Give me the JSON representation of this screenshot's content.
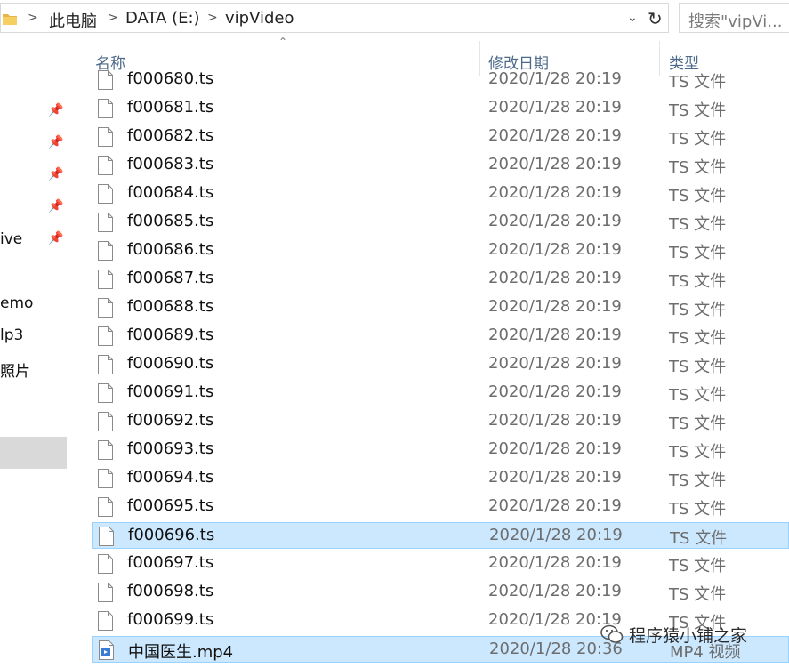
{
  "address": {
    "crumbs": [
      "此电脑",
      "DATA (E:)",
      "vipVideo"
    ],
    "separator": ">"
  },
  "search": {
    "placeholder": "搜索\"vipVi..."
  },
  "nav": {
    "labels": [
      "ive",
      "emo",
      "lp3",
      "照片"
    ]
  },
  "columns": {
    "name": "名称",
    "date": "修改日期",
    "type": "类型"
  },
  "files": [
    {
      "name": "f000680.ts",
      "date": "2020/1/28 20:19",
      "type": "TS 文件",
      "kind": "ts"
    },
    {
      "name": "f000681.ts",
      "date": "2020/1/28 20:19",
      "type": "TS 文件",
      "kind": "ts"
    },
    {
      "name": "f000682.ts",
      "date": "2020/1/28 20:19",
      "type": "TS 文件",
      "kind": "ts"
    },
    {
      "name": "f000683.ts",
      "date": "2020/1/28 20:19",
      "type": "TS 文件",
      "kind": "ts"
    },
    {
      "name": "f000684.ts",
      "date": "2020/1/28 20:19",
      "type": "TS 文件",
      "kind": "ts"
    },
    {
      "name": "f000685.ts",
      "date": "2020/1/28 20:19",
      "type": "TS 文件",
      "kind": "ts"
    },
    {
      "name": "f000686.ts",
      "date": "2020/1/28 20:19",
      "type": "TS 文件",
      "kind": "ts"
    },
    {
      "name": "f000687.ts",
      "date": "2020/1/28 20:19",
      "type": "TS 文件",
      "kind": "ts"
    },
    {
      "name": "f000688.ts",
      "date": "2020/1/28 20:19",
      "type": "TS 文件",
      "kind": "ts"
    },
    {
      "name": "f000689.ts",
      "date": "2020/1/28 20:19",
      "type": "TS 文件",
      "kind": "ts"
    },
    {
      "name": "f000690.ts",
      "date": "2020/1/28 20:19",
      "type": "TS 文件",
      "kind": "ts"
    },
    {
      "name": "f000691.ts",
      "date": "2020/1/28 20:19",
      "type": "TS 文件",
      "kind": "ts"
    },
    {
      "name": "f000692.ts",
      "date": "2020/1/28 20:19",
      "type": "TS 文件",
      "kind": "ts"
    },
    {
      "name": "f000693.ts",
      "date": "2020/1/28 20:19",
      "type": "TS 文件",
      "kind": "ts"
    },
    {
      "name": "f000694.ts",
      "date": "2020/1/28 20:19",
      "type": "TS 文件",
      "kind": "ts"
    },
    {
      "name": "f000695.ts",
      "date": "2020/1/28 20:19",
      "type": "TS 文件",
      "kind": "ts"
    },
    {
      "name": "f000696.ts",
      "date": "2020/1/28 20:19",
      "type": "TS 文件",
      "kind": "ts",
      "selected": true
    },
    {
      "name": "f000697.ts",
      "date": "2020/1/28 20:19",
      "type": "TS 文件",
      "kind": "ts"
    },
    {
      "name": "f000698.ts",
      "date": "2020/1/28 20:19",
      "type": "TS 文件",
      "kind": "ts"
    },
    {
      "name": "f000699.ts",
      "date": "2020/1/28 20:19",
      "type": "TS 文件",
      "kind": "ts"
    },
    {
      "name": "中国医生.mp4",
      "date": "2020/1/28 20:36",
      "type": "MP4 视频",
      "kind": "mp4",
      "selected": true
    }
  ],
  "watermark": {
    "text": "程序猿小铺之家"
  }
}
